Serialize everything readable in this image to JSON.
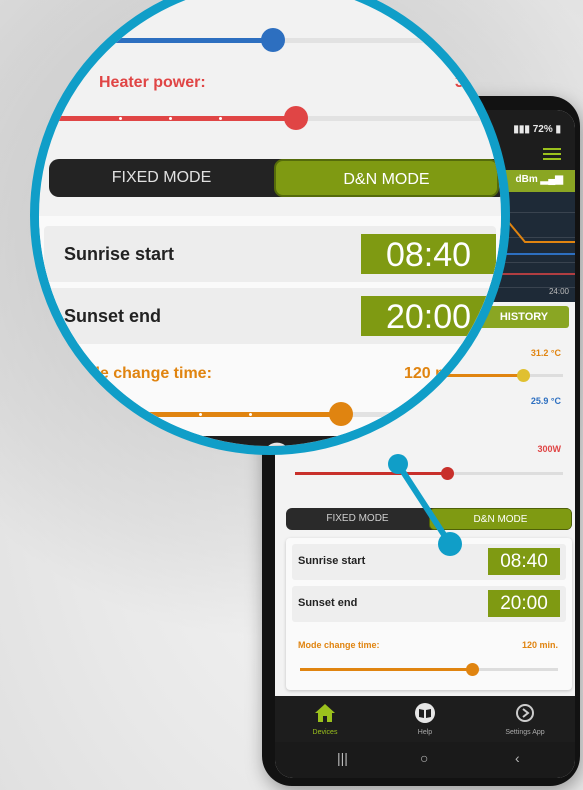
{
  "status_bar": {
    "battery": "72%"
  },
  "connection": {
    "signal_text": "dBm"
  },
  "chart": {
    "time_tick": "24:00"
  },
  "tabs": {
    "history": "HISTORY"
  },
  "readings": {
    "max_temp": "31.2 °C",
    "min_temp": "25.9 °C",
    "heater_power": "300W"
  },
  "heater": {
    "label": "Heater power:",
    "value": "3"
  },
  "mode": {
    "fixed": "FIXED MODE",
    "dn": "D&N MODE",
    "selected": "D&N MODE"
  },
  "schedule": {
    "sunrise_label": "Sunrise start",
    "sunrise_value": "08:40",
    "sunset_label": "Sunset end",
    "sunset_value": "20:00",
    "mode_change_label": "Mode change time:",
    "mode_change_value": "120 min.",
    "mode_change_fraction": 0.67
  },
  "bottom_nav": [
    {
      "label": "Devices",
      "icon": "home-icon",
      "active": true
    },
    {
      "label": "Help",
      "icon": "book-icon",
      "active": false
    },
    {
      "label": "Settings App",
      "icon": "settings-icon",
      "active": false
    }
  ],
  "colors": {
    "accent_green": "#7f9a12",
    "orange": "#e08410",
    "red": "#e04545",
    "blue": "#2d6fc0",
    "magnifier_ring": "#109ec8"
  }
}
